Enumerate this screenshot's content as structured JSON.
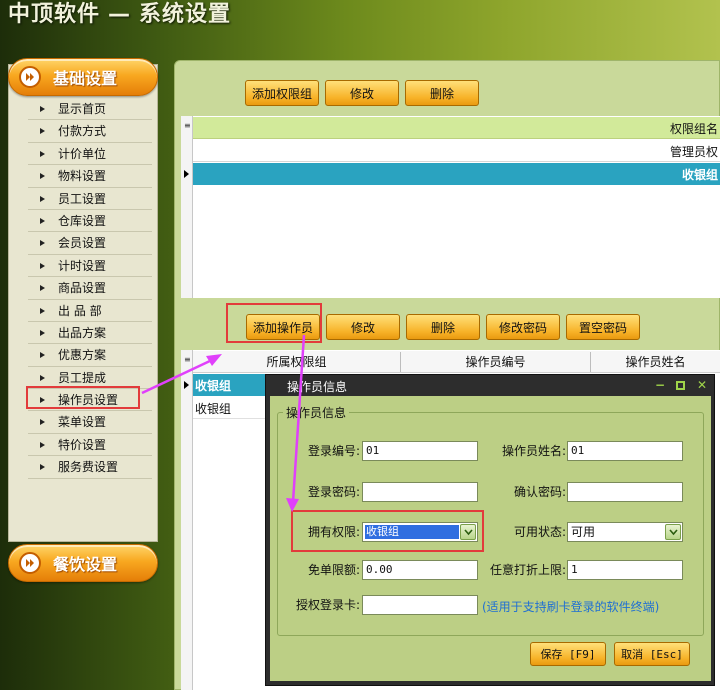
{
  "app": {
    "name": "中顶软件",
    "separator": "—",
    "section": "系统设置"
  },
  "sidebar": {
    "group1": "基础设置",
    "items": [
      "显示首页",
      "付款方式",
      "计价单位",
      "物料设置",
      "员工设置",
      "仓库设置",
      "会员设置",
      "计时设置",
      "商品设置",
      "出 品 部",
      "出品方案",
      "优惠方案",
      "员工提成",
      "操作员设置",
      "菜单设置",
      "特价设置",
      "服务费设置"
    ],
    "group2": "餐饮设置"
  },
  "perm_toolbar": {
    "add": "添加权限组",
    "edit": "修改",
    "delete": "删除"
  },
  "perm_grid": {
    "header": "权限组名",
    "rows": [
      "管理员权",
      "收银组"
    ]
  },
  "op_toolbar": {
    "add": "添加操作员",
    "edit": "修改",
    "delete": "删除",
    "change_pwd": "修改密码",
    "clear_pwd": "置空密码"
  },
  "op_grid": {
    "headers": [
      "所属权限组",
      "操作员编号",
      "操作员姓名"
    ],
    "rows": [
      "收银组",
      "收银组"
    ]
  },
  "dialog": {
    "title": "操作员信息",
    "group": "操作员信息",
    "login_id_label": "登录编号:",
    "login_id": "01",
    "name_label": "操作员姓名:",
    "name": "01",
    "password_label": "登录密码:",
    "password": "",
    "confirm_label": "确认密码:",
    "confirm": "",
    "permission_label": "拥有权限:",
    "permission": "收银组",
    "status_label": "可用状态:",
    "status": "可用",
    "free_limit_label": "免单限额:",
    "free_limit": "0.00",
    "discount_label": "任意打折上限:",
    "discount": "1",
    "card_label": "授权登录卡:",
    "card": "",
    "card_note": "(适用于支持刷卡登录的软件终端)",
    "save": "保存 [F9]",
    "cancel": "取消 [Esc]"
  },
  "colors": {
    "selected_row": "#2aa3c0",
    "highlight_box": "#e23b3b",
    "annotation_arrow": "#e040fb"
  }
}
